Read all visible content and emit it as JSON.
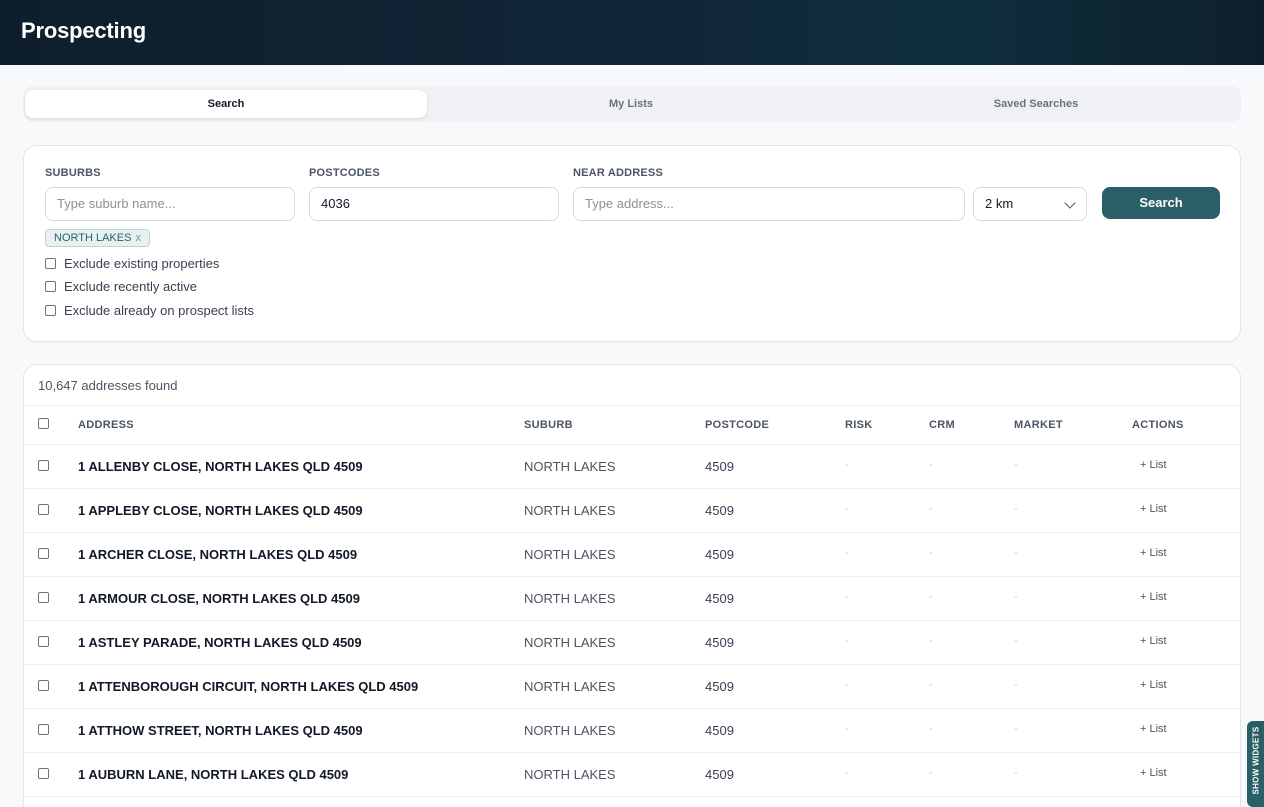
{
  "header": {
    "title": "Prospecting"
  },
  "tabs": [
    {
      "label": "Search",
      "active": true
    },
    {
      "label": "My Lists",
      "active": false
    },
    {
      "label": "Saved Searches",
      "active": false
    }
  ],
  "filters": {
    "suburbs_label": "SUBURBS",
    "suburbs_placeholder": "Type suburb name...",
    "postcodes_label": "POSTCODES",
    "postcodes_value": "4036",
    "near_label": "NEAR ADDRESS",
    "near_placeholder": "Type address...",
    "radius_value": "2 km",
    "search_label": "Search",
    "chip": {
      "label": "NORTH LAKES",
      "remove": "x"
    },
    "checkboxes": [
      "Exclude existing properties",
      "Exclude recently active",
      "Exclude already on prospect lists"
    ]
  },
  "results": {
    "count_text": "10,647 addresses found",
    "columns": [
      "ADDRESS",
      "SUBURB",
      "POSTCODE",
      "RISK",
      "CRM",
      "MARKET",
      "ACTIONS"
    ],
    "rows": [
      {
        "address": "1 ALLENBY CLOSE, NORTH LAKES QLD 4509",
        "suburb": "NORTH LAKES",
        "postcode": "4509",
        "risk": "-",
        "crm": "-",
        "market": "-",
        "action": "+ List"
      },
      {
        "address": "1 APPLEBY CLOSE, NORTH LAKES QLD 4509",
        "suburb": "NORTH LAKES",
        "postcode": "4509",
        "risk": "-",
        "crm": "-",
        "market": "-",
        "action": "+ List"
      },
      {
        "address": "1 ARCHER CLOSE, NORTH LAKES QLD 4509",
        "suburb": "NORTH LAKES",
        "postcode": "4509",
        "risk": "-",
        "crm": "-",
        "market": "-",
        "action": "+ List"
      },
      {
        "address": "1 ARMOUR CLOSE, NORTH LAKES QLD 4509",
        "suburb": "NORTH LAKES",
        "postcode": "4509",
        "risk": "-",
        "crm": "-",
        "market": "-",
        "action": "+ List"
      },
      {
        "address": "1 ASTLEY PARADE, NORTH LAKES QLD 4509",
        "suburb": "NORTH LAKES",
        "postcode": "4509",
        "risk": "-",
        "crm": "-",
        "market": "-",
        "action": "+ List"
      },
      {
        "address": "1 ATTENBOROUGH CIRCUIT, NORTH LAKES QLD 4509",
        "suburb": "NORTH LAKES",
        "postcode": "4509",
        "risk": "-",
        "crm": "-",
        "market": "-",
        "action": "+ List"
      },
      {
        "address": "1 ATTHOW STREET, NORTH LAKES QLD 4509",
        "suburb": "NORTH LAKES",
        "postcode": "4509",
        "risk": "-",
        "crm": "-",
        "market": "-",
        "action": "+ List"
      },
      {
        "address": "1 AUBURN LANE, NORTH LAKES QLD 4509",
        "suburb": "NORTH LAKES",
        "postcode": "4509",
        "risk": "-",
        "crm": "-",
        "market": "-",
        "action": "+ List"
      }
    ]
  },
  "widgets": {
    "label": "SHOW WIDGETS"
  }
}
